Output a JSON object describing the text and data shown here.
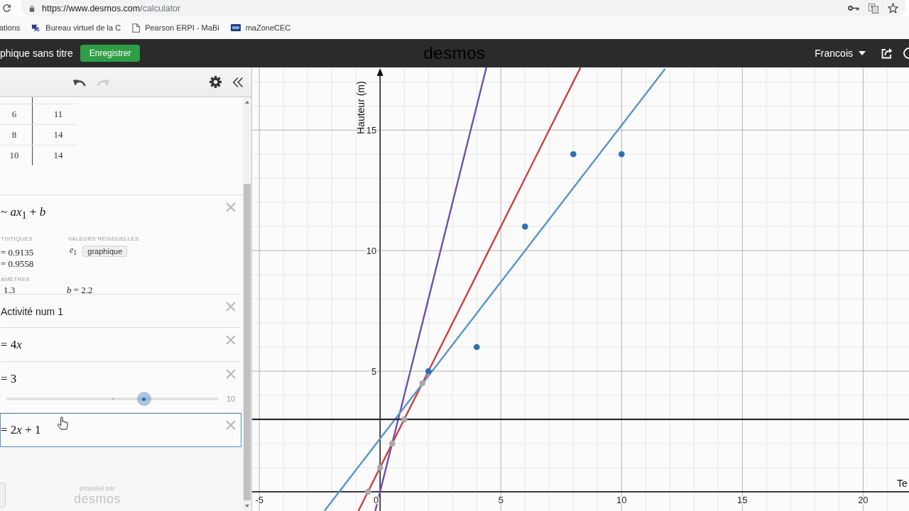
{
  "browser": {
    "url_host": "https://www.desmos.com",
    "url_path": "/calculator",
    "bookmarks": [
      {
        "kind": "plain",
        "label": "ations"
      },
      {
        "kind": "site",
        "label": "Bureau virtuel de la C"
      },
      {
        "kind": "page",
        "label": "Pearson ERPI - MaBi"
      },
      {
        "kind": "badge",
        "label": "maZoneCEC"
      }
    ]
  },
  "header": {
    "title": "phique sans titre",
    "save_button": "Enregistrer",
    "logo": "desmos",
    "user": "Francois"
  },
  "toolbar": {
    "undo_enabled": true,
    "redo_enabled": false
  },
  "table": {
    "rows": [
      [
        "6",
        "11"
      ],
      [
        "8",
        "14"
      ],
      [
        "10",
        "14"
      ]
    ]
  },
  "expressions": [
    {
      "kind": "regression",
      "selected": false,
      "formula": [
        "~ *ax*$_{1}$ + *b*"
      ],
      "stats_heading": "TISTIQUES",
      "stats": [
        "= 0.9135",
        "= 0.9558"
      ],
      "residuals_heading": "VALEURS RÉSIDUELLES",
      "residual_var": "*e*$_{1}$",
      "residual_button": "graphique",
      "params_heading": "AMÈTRES",
      "params": [
        "1.3",
        "*b* = 2.2"
      ]
    },
    {
      "kind": "note",
      "selected": false,
      "text": "Activité num 1"
    },
    {
      "kind": "expression",
      "selected": false,
      "formula": [
        "= 4",
        "*x*"
      ]
    },
    {
      "kind": "slider",
      "selected": false,
      "formula": [
        "= 3"
      ],
      "level": 0.65,
      "max": "10"
    },
    {
      "kind": "expression",
      "selected": true,
      "formula": [
        "= 2",
        "*x*",
        " + 1"
      ]
    }
  ],
  "footer": {
    "caption": "propulsé par",
    "logo": "desmos"
  },
  "graph": {
    "chart_data": {
      "type": "line",
      "xlabel": "Te",
      "ylabel": "Hauteur (m)",
      "x": [
        -5.3,
        -2.3,
        -0.9,
        -0.5,
        -0.2,
        0,
        0.5,
        1,
        1.75,
        2,
        4,
        4.4,
        6,
        8,
        8.3,
        10,
        11.8,
        21.9
      ],
      "series": [
        {
          "type": "line",
          "color": "#6f4fb0",
          "values": [
            null,
            null,
            null,
            null,
            -0.8,
            0,
            2,
            4,
            7,
            8,
            16,
            17.6,
            null,
            null,
            null,
            null,
            null,
            null
          ]
        },
        {
          "type": "line",
          "color": "#c74440",
          "values": [
            null,
            null,
            -0.8,
            0,
            0.6,
            1,
            2,
            3,
            4.5,
            5,
            9,
            9.8,
            13,
            17,
            17.6,
            null,
            null,
            null
          ]
        },
        {
          "type": "line",
          "color": "#5a94cc",
          "values": [
            null,
            -0.79,
            1.03,
            1.55,
            1.94,
            2.2,
            2.85,
            3.5,
            4.48,
            4.8,
            7.4,
            7.92,
            10,
            12.6,
            12.99,
            15.2,
            17.54,
            null
          ]
        },
        {
          "type": "line",
          "color": "#2b2b2b",
          "values": [
            3,
            3,
            3,
            3,
            3,
            3,
            3,
            3,
            3,
            3,
            3,
            3,
            3,
            3,
            3,
            3,
            3,
            3
          ]
        },
        {
          "type": "scatter",
          "color": "#2d70b3",
          "values": [
            null,
            null,
            null,
            null,
            null,
            null,
            null,
            null,
            null,
            5,
            6,
            null,
            11,
            14,
            null,
            14,
            null,
            null
          ]
        },
        {
          "type": "scatter",
          "color": "#a9a9a9",
          "values": [
            null,
            null,
            null,
            0,
            null,
            1,
            2,
            3,
            4.5,
            null,
            null,
            null,
            null,
            null,
            null,
            null,
            null,
            null
          ]
        }
      ],
      "xlim": [
        -5.3,
        21.9
      ],
      "ylim": [
        -0.8,
        17.6
      ],
      "xticks": [
        -5,
        0,
        5,
        10,
        15,
        20
      ],
      "yticks": [
        5,
        10,
        15
      ]
    }
  }
}
